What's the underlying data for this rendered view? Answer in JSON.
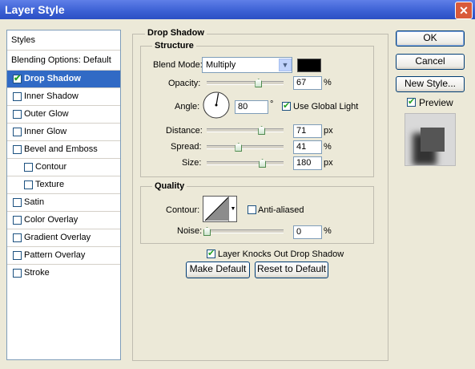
{
  "window": {
    "title": "Layer Style"
  },
  "sidebar": {
    "header": "Styles",
    "items": [
      {
        "label": "Blending Options: Default",
        "checkbox": false,
        "checked": false,
        "selected": false
      },
      {
        "label": "Drop Shadow",
        "checkbox": true,
        "checked": true,
        "selected": true
      },
      {
        "label": "Inner Shadow",
        "checkbox": true,
        "checked": false,
        "selected": false
      },
      {
        "label": "Outer Glow",
        "checkbox": true,
        "checked": false,
        "selected": false
      },
      {
        "label": "Inner Glow",
        "checkbox": true,
        "checked": false,
        "selected": false
      },
      {
        "label": "Bevel and Emboss",
        "checkbox": true,
        "checked": false,
        "selected": false
      },
      {
        "label": "Contour",
        "checkbox": true,
        "checked": false,
        "selected": false
      },
      {
        "label": "Texture",
        "checkbox": true,
        "checked": false,
        "selected": false
      },
      {
        "label": "Satin",
        "checkbox": true,
        "checked": false,
        "selected": false
      },
      {
        "label": "Color Overlay",
        "checkbox": true,
        "checked": false,
        "selected": false
      },
      {
        "label": "Gradient Overlay",
        "checkbox": true,
        "checked": false,
        "selected": false
      },
      {
        "label": "Pattern Overlay",
        "checkbox": true,
        "checked": false,
        "selected": false
      },
      {
        "label": "Stroke",
        "checkbox": true,
        "checked": false,
        "selected": false
      }
    ]
  },
  "panel": {
    "title": "Drop Shadow",
    "structure": {
      "title": "Structure",
      "blend_mode_label": "Blend Mode:",
      "blend_mode_value": "Multiply",
      "shadow_color": "#000000",
      "opacity_label": "Opacity:",
      "opacity_value": "67",
      "opacity_unit": "%",
      "opacity_level": 0.67,
      "angle_label": "Angle:",
      "angle_value": "80",
      "angle_unit": "°",
      "use_global_light_label": "Use Global Light",
      "use_global_light_checked": true,
      "distance_label": "Distance:",
      "distance_value": "71",
      "distance_unit": "px",
      "distance_level": 0.71,
      "spread_label": "Spread:",
      "spread_value": "41",
      "spread_unit": "%",
      "spread_level": 0.41,
      "size_label": "Size:",
      "size_value": "180",
      "size_unit": "px",
      "size_level": 0.72
    },
    "quality": {
      "title": "Quality",
      "contour_label": "Contour:",
      "anti_aliased_label": "Anti-aliased",
      "anti_aliased_checked": false,
      "noise_label": "Noise:",
      "noise_value": "0",
      "noise_unit": "%",
      "noise_level": 0
    },
    "knockout_label": "Layer Knocks Out Drop Shadow",
    "knockout_checked": true,
    "make_default_label": "Make Default",
    "reset_default_label": "Reset to Default"
  },
  "actions": {
    "ok_label": "OK",
    "cancel_label": "Cancel",
    "new_style_label": "New Style...",
    "preview_label": "Preview",
    "preview_checked": true
  },
  "colors": {
    "accent": "#316ac5",
    "titlebar": "#3a5fd3"
  }
}
